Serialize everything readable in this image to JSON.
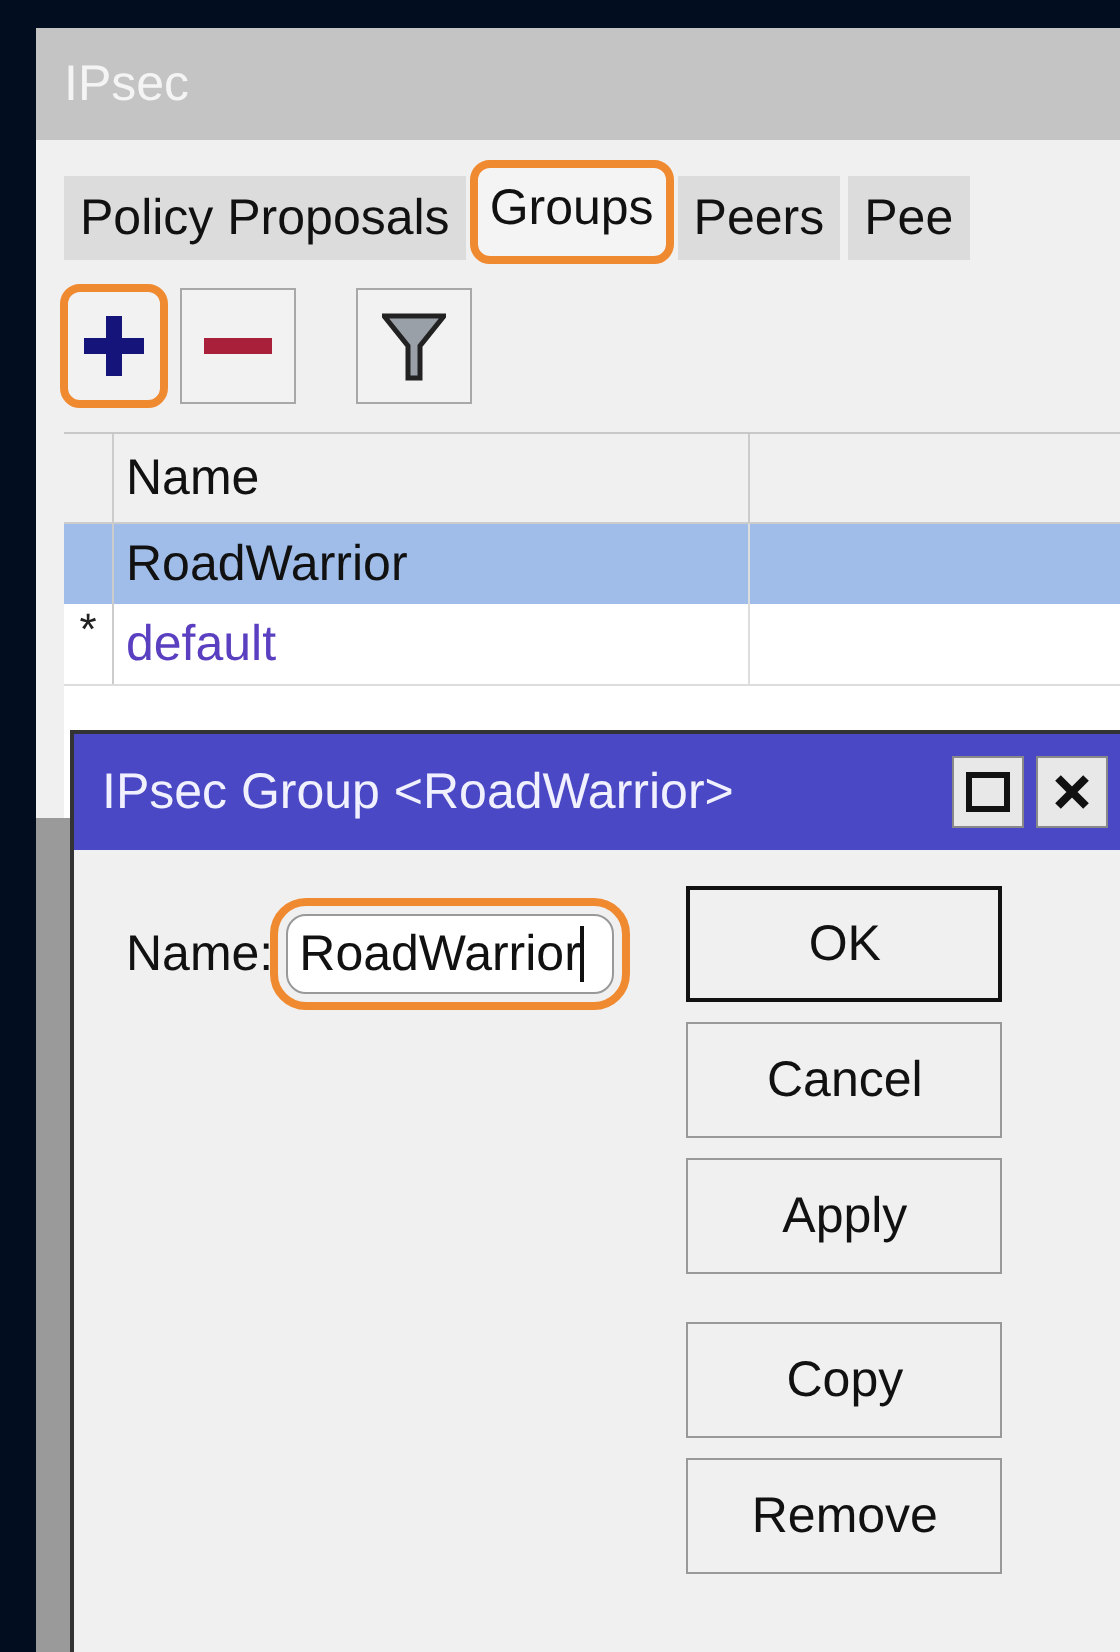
{
  "window": {
    "title": "IPsec"
  },
  "tabs": [
    {
      "label": "Policy Proposals",
      "selected": false,
      "highlighted": false
    },
    {
      "label": "Groups",
      "selected": true,
      "highlighted": true
    },
    {
      "label": "Peers",
      "selected": false,
      "highlighted": false
    },
    {
      "label": "Pee",
      "selected": false,
      "highlighted": false
    }
  ],
  "toolbar": [
    {
      "kind": "add",
      "highlighted": true
    },
    {
      "kind": "remove",
      "highlighted": false
    },
    {
      "kind": "filter",
      "highlighted": false
    }
  ],
  "table": {
    "columns": [
      "Name"
    ],
    "rows": [
      {
        "marker": "",
        "name": "RoadWarrior",
        "selected": true,
        "kind": "normal"
      },
      {
        "marker": "*",
        "name": "default",
        "selected": false,
        "kind": "default"
      }
    ]
  },
  "dialog": {
    "title": "IPsec Group <RoadWarrior>",
    "field": {
      "label": "Name:",
      "value": "RoadWarrior",
      "highlighted": true
    },
    "button_groups": [
      [
        {
          "label": "OK",
          "default": true
        },
        {
          "label": "Cancel",
          "default": false
        },
        {
          "label": "Apply",
          "default": false
        }
      ],
      [
        {
          "label": "Copy",
          "default": false
        },
        {
          "label": "Remove",
          "default": false
        }
      ]
    ]
  }
}
